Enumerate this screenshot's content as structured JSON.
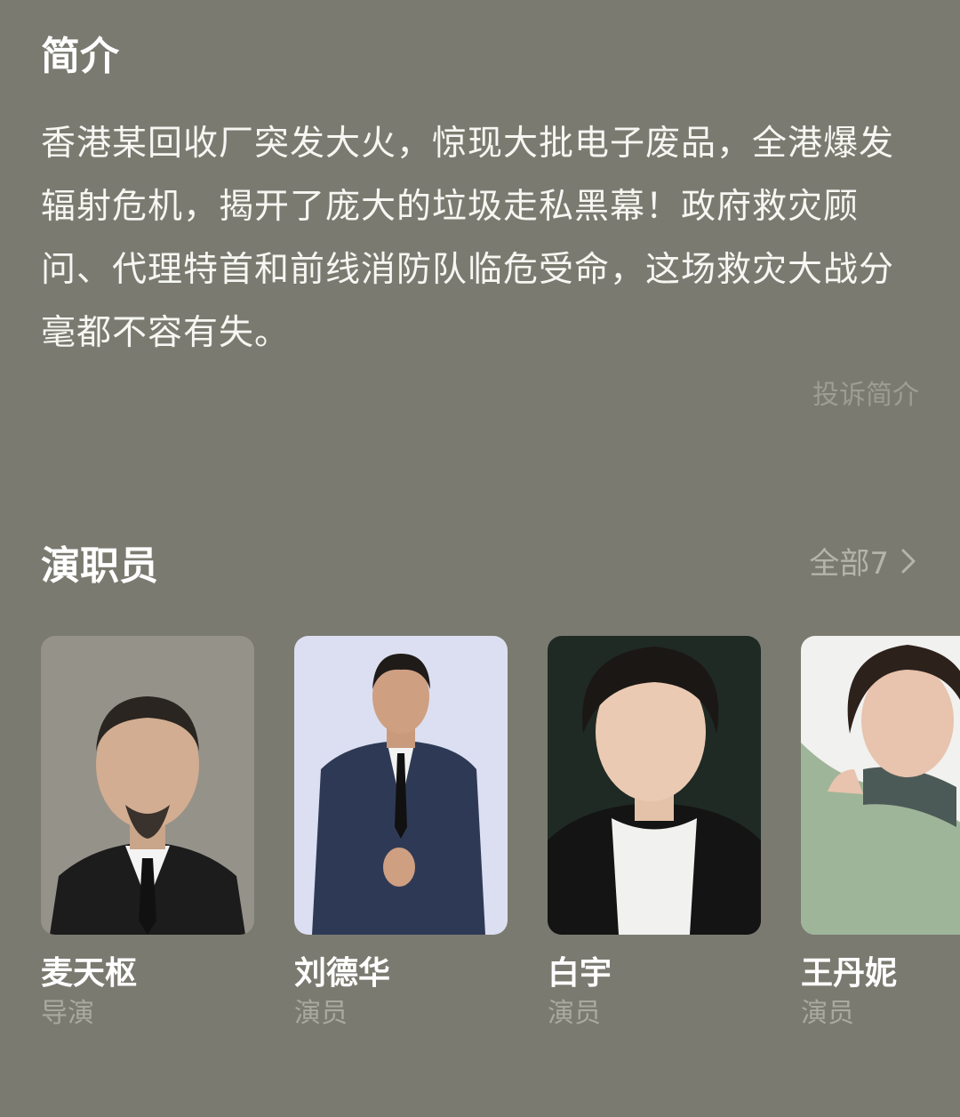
{
  "intro": {
    "title": "简介",
    "text": "香港某回收厂突发大火，惊现大批电子废品，全港爆发辐射危机，揭开了庞大的垃圾走私黑幕！政府救灾顾问、代理特首和前线消防队临危受命，这场救灾大战分毫都不容有失。",
    "report_label": "投诉简介"
  },
  "cast": {
    "title": "演职员",
    "all_label": "全部7",
    "all_icon": "chevron-right-icon",
    "members": [
      {
        "name": "麦天枢",
        "role": "导演",
        "photo_bg": "#8f8c85",
        "suit": "#1c1c1c"
      },
      {
        "name": "刘德华",
        "role": "演员",
        "photo_bg": "#dcdff1",
        "suit": "#2e3a55"
      },
      {
        "name": "白宇",
        "role": "演员",
        "photo_bg": "#1f2a24",
        "suit": "#141414"
      },
      {
        "name": "王丹妮",
        "role": "演员",
        "photo_bg": "#f1f1ef",
        "suit": "#9fb59a"
      }
    ]
  },
  "colors": {
    "background": "#7a7a70",
    "muted_text": "#a9a9a0"
  }
}
